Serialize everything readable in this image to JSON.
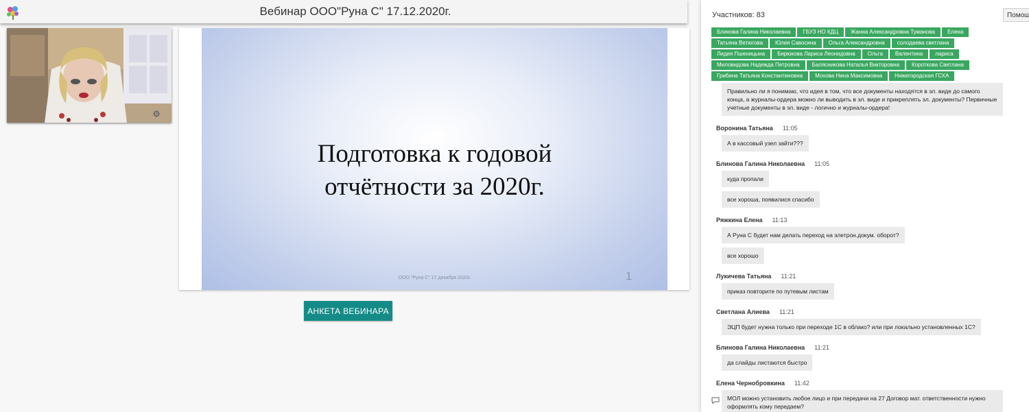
{
  "header": {
    "title": "Вебинар ООО\"Руна С\" 17.12.2020г."
  },
  "slide": {
    "title_line1": "Подготовка к годовой",
    "title_line2": "отчётности за 2020г.",
    "footer": "ООО \"Руна С\"  17 декабря 2020г.",
    "page_number": "1"
  },
  "survey_button": {
    "label": "АНКЕТА ВЕБИНАРА"
  },
  "panel": {
    "participants_label": "Участников: 83",
    "help_label": "Помощь",
    "participants": [
      "Блинова Галина Николаевна",
      "ГБУЗ НО КДЦ",
      "Жанна Александровна Туманова",
      "Елена",
      "Татьяна Ветюгова",
      "Юлия Савосина",
      "Ольга Александровна",
      "солодаева светлана",
      "Лидия Пшеницына",
      "Бирюкова Лариса Леонидовна",
      "Ольга",
      "Валентина",
      "лариса",
      "Миловидова Надежда Петровна",
      "Балясникова Наталья Викторовна",
      "Короткова Светлана",
      "Грибина Татьяна Константиновна",
      "Мохова Нина Максимовна",
      "Нижегородская ГСХА"
    ]
  },
  "chat": {
    "m0": {
      "text": "Правильно ли я понимаю, что идея в том, что все документы находятся в эл. виде до самого конца, а журналы-ордера можно ли выводить в эл. виде и прикреплять эл. документы? Первичные учетные документы в эл. виде - логично и журналы-ордера!"
    },
    "m1": {
      "author": "Воронина Татьяна",
      "time": "11:05",
      "text": "А в кассовый узел зайти???"
    },
    "m2": {
      "author": "Блинова Галина Николаевна",
      "time": "11:05",
      "text1": "куда пропали",
      "text2": "все хороша, появилися спасибо"
    },
    "m3": {
      "author": "Ряжкина Елена",
      "time": "11:13",
      "text1": "А Руна С будет нам делать переход на элетрон.докум. оборот?",
      "text2": "все хорошо"
    },
    "m4": {
      "author": "Лукичева Татьяна",
      "time": "11:21",
      "text": "приказ повторите по путевым листам"
    },
    "m5": {
      "author": "Светлана Алиева",
      "time": "11:21",
      "text": "ЭЦП будет нужна только при переходе 1С в облако? или при локально установленных 1С?"
    },
    "m6": {
      "author": "Блинова Галина Николаевна",
      "time": "11:21",
      "text": "да слайды листаются быстро"
    },
    "m7": {
      "author": "Елена Чернобровкина",
      "time": "11:42",
      "text": "МОЛ можно установить любое лицо и при передачи на 27 Договор мат. ответственности нужно оформлять кому передаем?"
    }
  },
  "colors": {
    "accent": "#158b88",
    "chip": "#3aa760"
  },
  "icons": {
    "logo": "colorful-flower-logo",
    "settings": "gear-icon",
    "reply": "speech-bubble-icon"
  }
}
